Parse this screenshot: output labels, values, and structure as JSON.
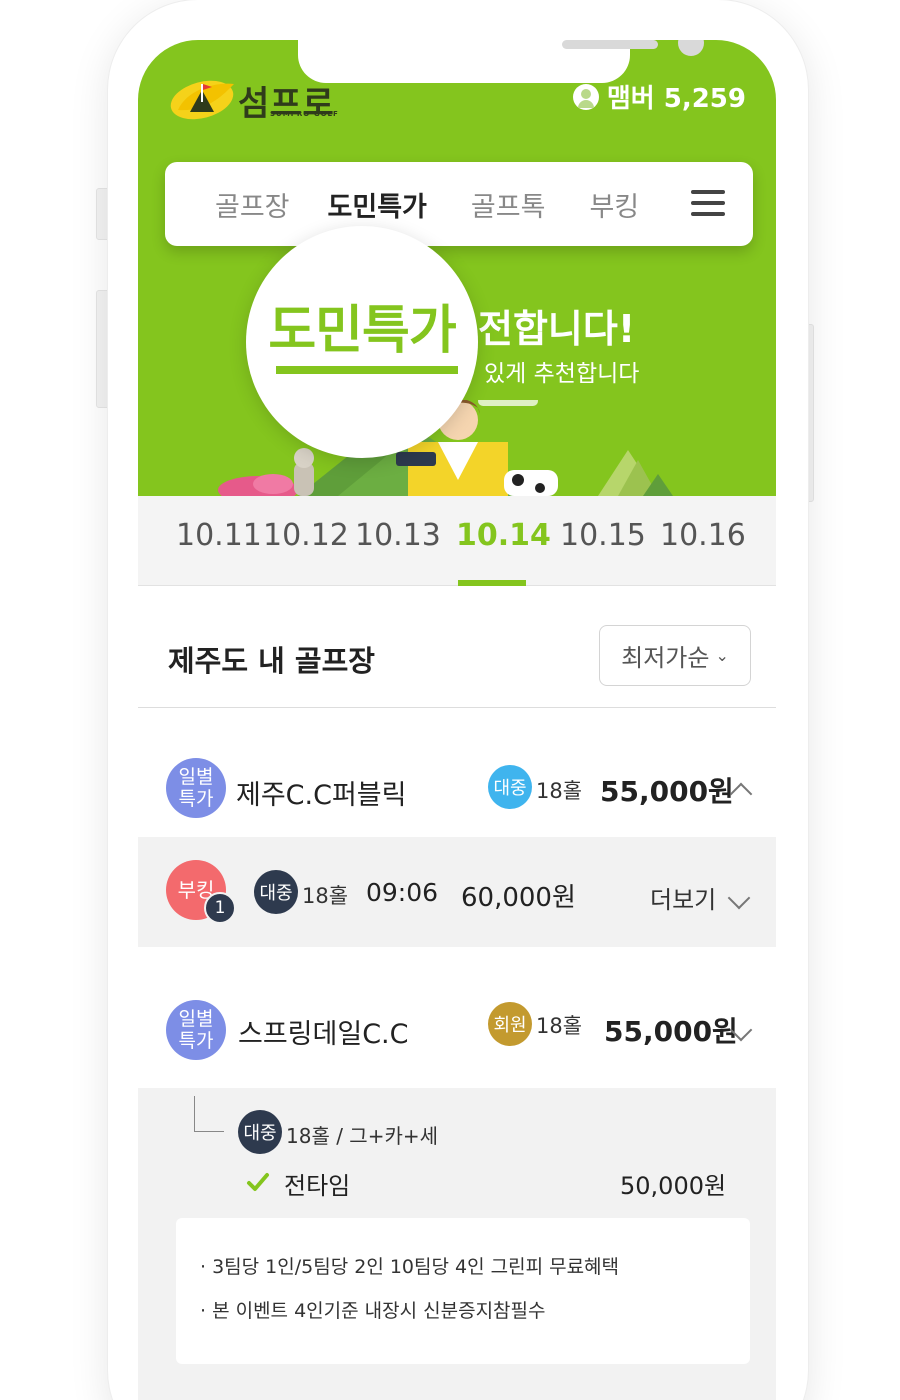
{
  "brand": {
    "name": "섬프로",
    "sub": "SUMPRO·GOLF"
  },
  "member": {
    "label": "맴버 5,259"
  },
  "nav": {
    "items": [
      "골프장",
      "도민특가",
      "골프톡",
      "부킹"
    ],
    "active": "도민특가"
  },
  "hero": {
    "magnifier_text": "도민특가",
    "title_partial": "전합니다!",
    "subtitle_partial": "있게 추천합니다"
  },
  "dates": {
    "items": [
      "10.11",
      "10.12",
      "10.13",
      "10.14",
      "10.15",
      "10.16"
    ],
    "selected": "10.14"
  },
  "section": {
    "title": "제주도 내 골프장",
    "sort_label": "최저가순"
  },
  "courses": [
    {
      "badge": [
        "일별",
        "특가"
      ],
      "name": "제주C.C퍼블릭",
      "type": "대중",
      "holes": "18홀",
      "price": "55,000원",
      "expanded": true,
      "booking": {
        "badge": "부킹",
        "count": "1",
        "type": "대중",
        "holes": "18홀",
        "time": "09:06",
        "price": "60,000원",
        "more": "더보기"
      }
    },
    {
      "badge": [
        "일별",
        "특가"
      ],
      "name": "스프링데일C.C",
      "type": "회원",
      "holes": "18홀",
      "price": "55,000원",
      "expanded": false,
      "detail": {
        "type": "대중",
        "holes_note": "18홀 / 그+카+세",
        "option": "전타임",
        "option_price": "50,000원",
        "notices": [
          "· 3팀당 1인/5팀당 2인 10팀당 4인 그린피 무료혜택",
          "· 본 이벤트 4인기준 내장시 신분증지참필수"
        ]
      }
    }
  ],
  "colors": {
    "brand_green": "#84c51e",
    "public_blue": "#3fb4ee",
    "daily_purple": "#7d8ee6",
    "booking_red": "#f36a6d",
    "dark_navy": "#2e3a4e",
    "member_gold": "#c39a2f"
  }
}
